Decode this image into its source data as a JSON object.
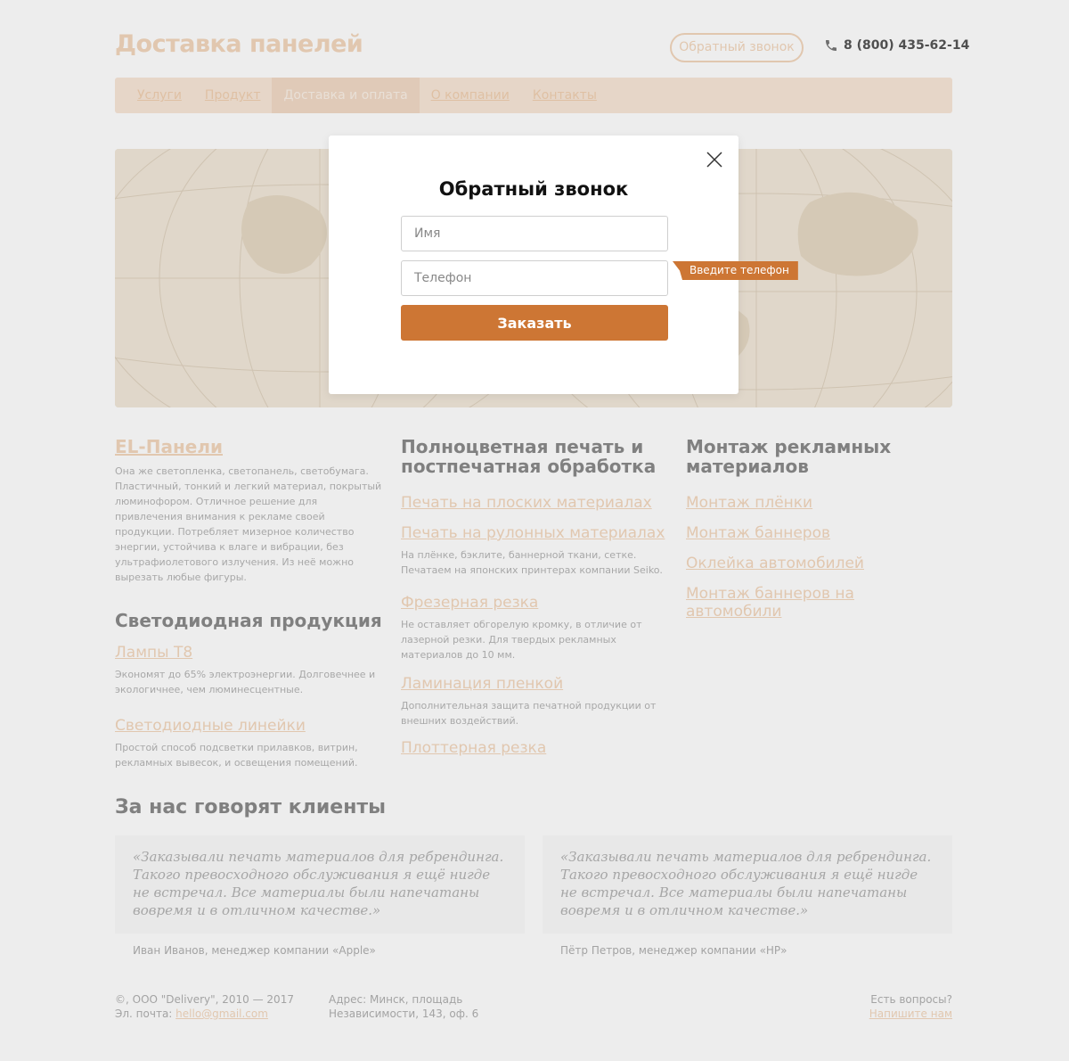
{
  "header": {
    "logo": "Доставка панелей",
    "callback_label": "Обратный звонок",
    "phone": "8 (800) 435-62-14"
  },
  "nav": {
    "items": [
      {
        "label": "Услуги"
      },
      {
        "label": "Продукт"
      },
      {
        "label": "Доставка и оплата"
      },
      {
        "label": "О компании"
      },
      {
        "label": "Контакты"
      }
    ]
  },
  "columns": {
    "col1": {
      "title": "EL-Панели",
      "text": "Она же светопленка, светопанель, светобумага. Пластичный, тонкий и легкий материал, покрытый люминофором. Отличное решение для привлечения внимания к рекламе своей продукции. Потребляет мизерное количество энергии, устойчива к влаге и вибрации, без ультрафиолетового излучения. Из неё можно вырезать любые фигуры.",
      "subtitle": "Светодиодная продукция",
      "links": [
        {
          "label": "Лампы Т8",
          "text": "Экономят до 65% электроэнергии. Долговечнее и экологичнее, чем люминесцентные."
        },
        {
          "label": "Светодиодные линейки",
          "text": "Простой способ подсветки прилавков, витрин, рекламных вывесок, и освещения помещений."
        }
      ]
    },
    "col2": {
      "title": "Полноцветная печать и постпечатная обработка",
      "links": [
        {
          "label": "Печать на плоских материалах",
          "text": ""
        },
        {
          "label": "Печать на рулонных материалах",
          "text": "На плёнке, бэклите, баннерной ткани, сетке. Печатаем на японских принтерах компании Seiko."
        },
        {
          "label": "Фрезерная резка",
          "text": "Не оставляет обгорелую кромку, в отличие от лазерной резки. Для твердых рекламных материалов до 10 мм."
        },
        {
          "label": "Ламинация пленкой",
          "text": "Дополнительная защита печатной продукции от внешних воздействий."
        },
        {
          "label": "Плоттерная резка",
          "text": ""
        }
      ]
    },
    "col3": {
      "title": "Монтаж рекламных материалов",
      "links": [
        {
          "label": "Монтаж плёнки"
        },
        {
          "label": "Монтаж баннеров"
        },
        {
          "label": "Оклейка автомобилей"
        },
        {
          "label": "Монтаж баннеров на автомобили"
        }
      ]
    }
  },
  "reviews": {
    "title": "За нас говорят клиенты",
    "items": [
      {
        "quote": "«Заказывали печать материалов для ребрендинга. Такого превосходного обслуживания я ещё нигде не встречал. Все материалы были напечатаны вовремя и в отличном качестве.»",
        "author": "Иван Иванов, менеджер компании «Apple»"
      },
      {
        "quote": "«Заказывали печать материалов для ребрендинга. Такого превосходного обслуживания я ещё нигде не встречал. Все материалы были напечатаны вовремя и в отличном качестве.»",
        "author": "Пётр Петров, менеджер компании «HP»"
      }
    ]
  },
  "footer": {
    "copyright": "©, ООО \"Delivery\", 2010 — 2017",
    "email_label": "Эл. почта: ",
    "email": "hello@gmail.com",
    "address_line1": "Адрес: Минск, площадь",
    "address_line2": "Независимости, 143, оф. 6",
    "questions": "Есть вопросы?",
    "write_us": "Напишите нам"
  },
  "modal": {
    "title": "Обратный звонок",
    "name_placeholder": "Имя",
    "name_value": "",
    "phone_placeholder": "Телефон",
    "phone_value": "",
    "submit_label": "Заказать",
    "tooltip": "Введите телефон"
  },
  "colors": {
    "accent": "#cd7634",
    "accent_faded": "#f3d7bd"
  },
  "icons": {
    "phone": "phone-icon",
    "close": "close-icon"
  }
}
